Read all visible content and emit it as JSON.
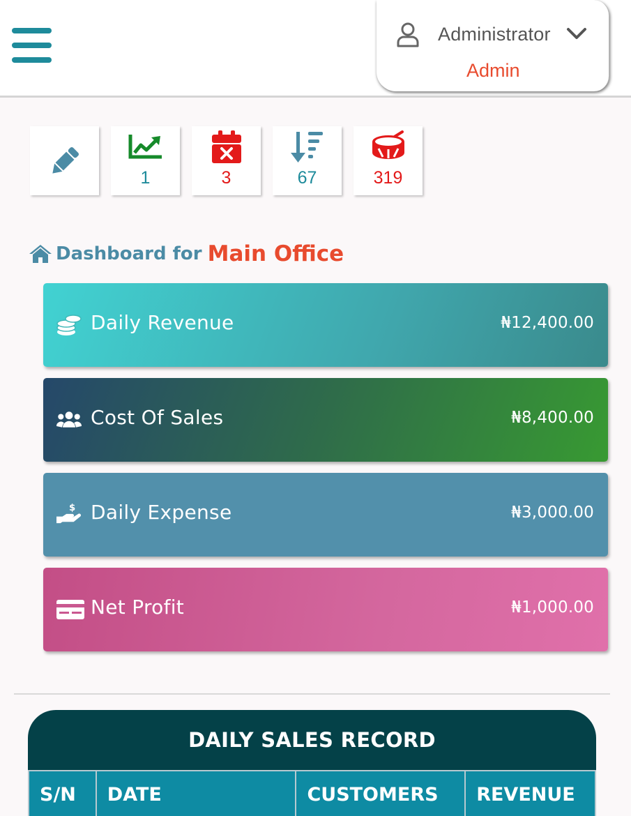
{
  "header": {
    "menu_icon": "hamburger-menu-icon",
    "user": {
      "icon": "user-icon",
      "name": "Administrator",
      "role": "Admin",
      "dropdown_icon": "chevron-down-icon"
    }
  },
  "tiles": [
    {
      "icon": "pencil-icon",
      "count": "",
      "color": "#4b8ba5"
    },
    {
      "icon": "trend-chart-icon",
      "count": "1",
      "color": "#1e8b9b"
    },
    {
      "icon": "calendar-x-icon",
      "count": "3",
      "color": "#e31a1a"
    },
    {
      "icon": "sort-descending-icon",
      "count": "67",
      "color": "#1e8b9b"
    },
    {
      "icon": "drum-icon",
      "count": "319",
      "color": "#e31a1a"
    }
  ],
  "dashboard": {
    "home_icon": "home-icon",
    "label": "Dashboard for",
    "office": "Main Office"
  },
  "cards": [
    {
      "icon": "coins-icon",
      "title": "Daily Revenue",
      "value": "₦12,400.00"
    },
    {
      "icon": "users-icon",
      "title": "Cost Of Sales",
      "value": "₦8,400.00"
    },
    {
      "icon": "hand-dollar-icon",
      "title": "Daily Expense",
      "value": "₦3,000.00"
    },
    {
      "icon": "money-card-icon",
      "title": "Net Profit",
      "value": "₦1,000.00"
    }
  ],
  "sales_record": {
    "title": "DAILY SALES RECORD",
    "columns": [
      "S/N",
      "DATE",
      "CUSTOMERS",
      "REVENUE"
    ]
  },
  "colors": {
    "accent_teal": "#1e8b9b",
    "accent_orange": "#e84b2e",
    "table_header_dark": "#044148",
    "table_header": "#0e8ba3"
  }
}
